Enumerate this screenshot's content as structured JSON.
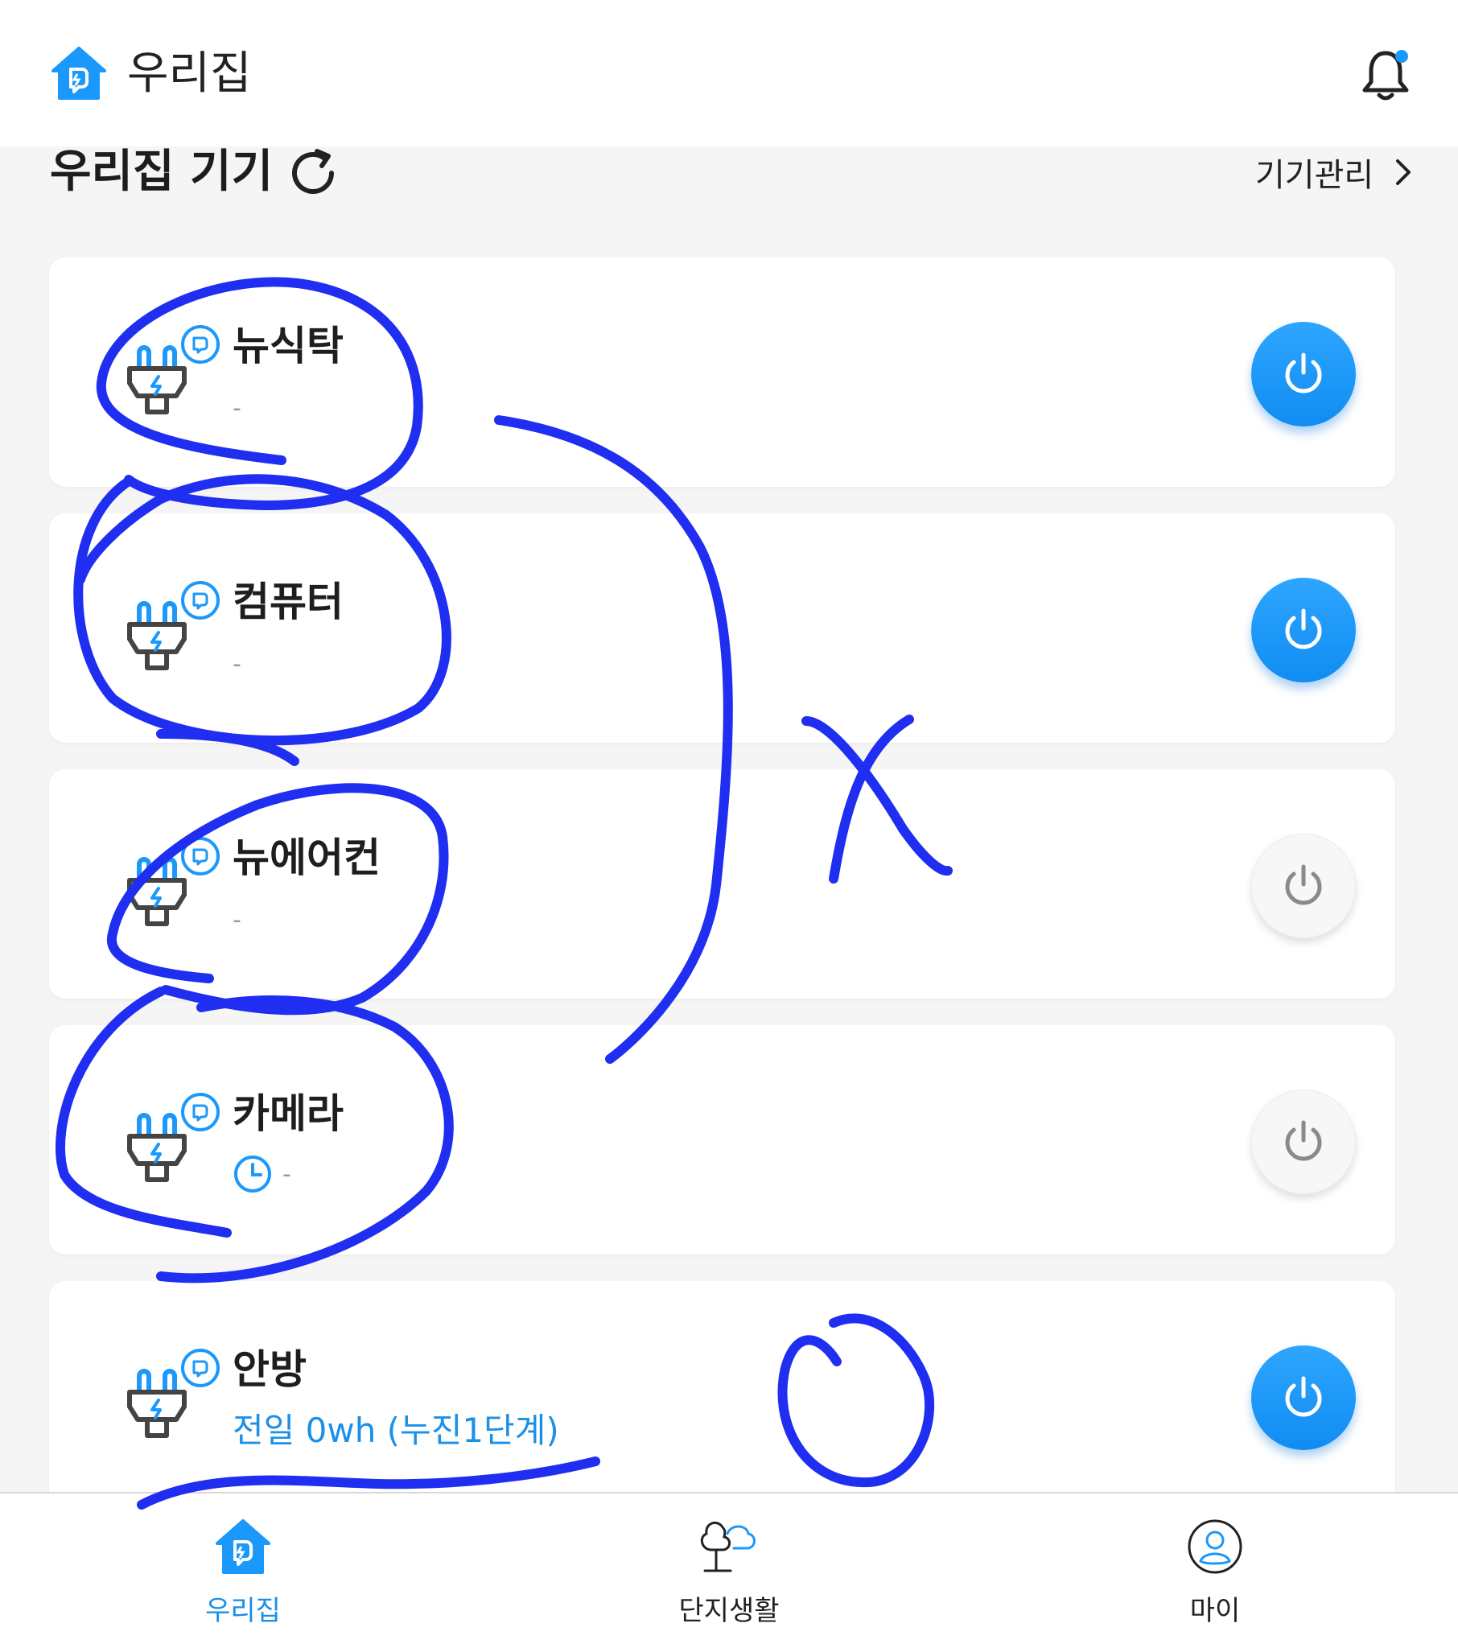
{
  "header": {
    "title": "우리집"
  },
  "section": {
    "title": "우리집 기기",
    "manage_label": "기기관리"
  },
  "devices": [
    {
      "name": "뉴식탁",
      "sub": "-",
      "power": "on"
    },
    {
      "name": "컴퓨터",
      "sub": "-",
      "power": "on"
    },
    {
      "name": "뉴에어컨",
      "sub": "-",
      "power": "off"
    },
    {
      "name": "카메라",
      "sub": "-",
      "power": "off",
      "timer": true
    },
    {
      "name": "안방",
      "sub": "전일 0wh (누진1단계)",
      "power": "on"
    }
  ],
  "nav": {
    "items": [
      {
        "label": "우리집",
        "icon": "home-icon",
        "active": true
      },
      {
        "label": "단지생활",
        "icon": "tree-cloud-icon",
        "active": false
      },
      {
        "label": "마이",
        "icon": "profile-icon",
        "active": false
      }
    ]
  },
  "colors": {
    "accent": "#1a90e8",
    "power_on": "#1a98fb",
    "scribble": "#1f2ef0"
  },
  "icons": [
    "home-icon",
    "bell-icon",
    "refresh-icon",
    "chevron-right-icon",
    "plug-icon",
    "power-icon",
    "clock-icon"
  ]
}
